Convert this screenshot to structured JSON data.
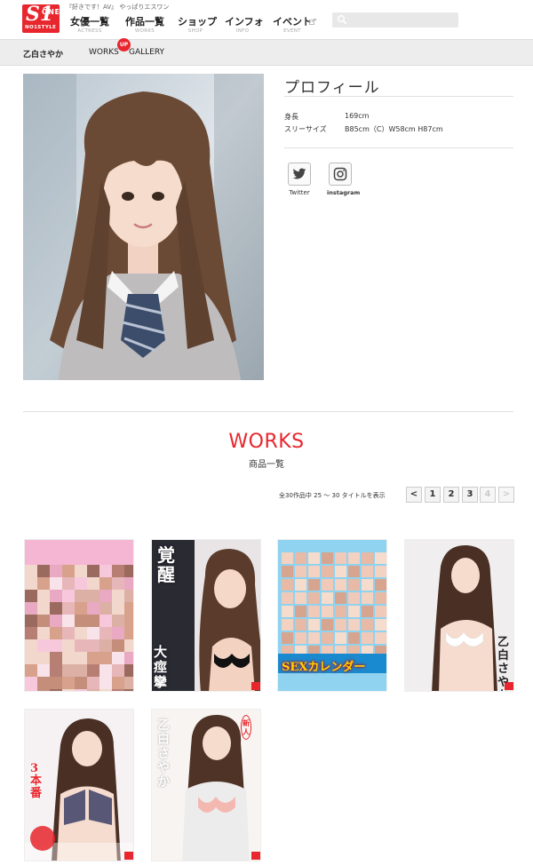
{
  "header": {
    "tagline": "『好きです！AV』 やっぱりエスワン",
    "logo_text": "S1",
    "logo_one": "ONE",
    "logo_sub": "NO1STYLE",
    "nav": [
      {
        "jp": "女優一覧",
        "en": "ACTRESS"
      },
      {
        "jp": "作品一覧",
        "en": "WORKS"
      },
      {
        "jp": "ショップ",
        "en": "SHOP"
      },
      {
        "jp": "インフォ",
        "en": "INFO"
      },
      {
        "jp": "イベント",
        "en": "EVENT"
      }
    ],
    "search_placeholder": ""
  },
  "subbar": {
    "actress_name": "乙白さやか",
    "works_label": "WORKS",
    "up_badge": "UP",
    "gallery_label": "GALLERY"
  },
  "profile": {
    "title": "プロフィール",
    "rows": [
      {
        "label": "身長",
        "value": "169cm"
      },
      {
        "label": "スリーサイズ",
        "value": "B85cm（C）W58cm H87cm"
      }
    ],
    "social": [
      {
        "label": "Twitter",
        "icon": "twitter-icon"
      },
      {
        "label": "instagram",
        "icon": "instagram-icon"
      }
    ]
  },
  "works": {
    "title": "WORKS",
    "subtitle": "商品一覧",
    "count_text": "全30作品中 25 〜 30 タイトルを表示",
    "pagination": [
      "<",
      "1",
      "2",
      "3",
      "4",
      ">"
    ],
    "covers": [
      {
        "alt": "mosaic-cover"
      },
      {
        "alt": "awakening-cover",
        "text": "覚醒",
        "text2": "大痙攣"
      },
      {
        "alt": "collection-cover",
        "text": "SEXカレンダー"
      },
      {
        "alt": "white-lingerie-cover",
        "text": "乙白さやか"
      },
      {
        "alt": "bikini-cover",
        "text": "3本番"
      },
      {
        "alt": "debut-cover",
        "text": "乙白さやか",
        "text2": "新人"
      }
    ]
  },
  "colors": {
    "accent": "#e8262d",
    "subbar_bg": "#ededed"
  }
}
